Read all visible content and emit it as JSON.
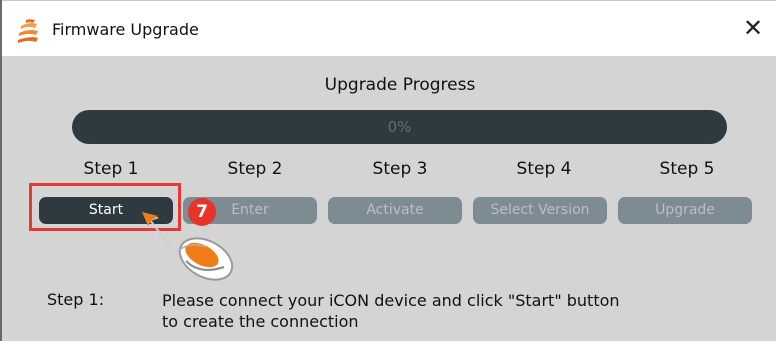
{
  "window": {
    "title": "Firmware Upgrade",
    "close_label": "✕"
  },
  "progress": {
    "title": "Upgrade Progress",
    "text": "0%",
    "value": 0
  },
  "steps": [
    {
      "label": "Step 1",
      "button": "Start",
      "active": true
    },
    {
      "label": "Step 2",
      "button": "Enter",
      "active": false
    },
    {
      "label": "Step 3",
      "button": "Activate",
      "active": false
    },
    {
      "label": "Step 4",
      "button": "Select Version",
      "active": false
    },
    {
      "label": "Step 5",
      "button": "Upgrade",
      "active": false
    }
  ],
  "annotation": {
    "badge_number": "7"
  },
  "instruction": {
    "step": "Step 1:",
    "text_line1": "Please connect your iCON device and click \"Start\" button",
    "text_line2": "to create the connection"
  },
  "colors": {
    "dark_slate": "#2f3a40",
    "disabled_button": "#7d8b93",
    "highlight_red": "#e53935",
    "badge_red": "#e8332a",
    "mouse_orange": "#f07c1a"
  }
}
